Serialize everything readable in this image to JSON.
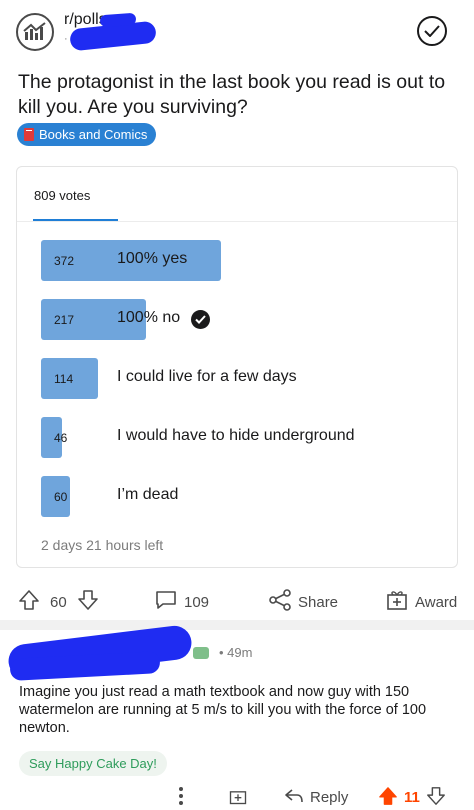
{
  "post": {
    "subreddit": "r/polls",
    "title": "The protagonist in the last book you read is out to kill you. Are you surviving?",
    "flair": "Books and Comics"
  },
  "poll": {
    "votes_label": "809 votes",
    "options": [
      {
        "count": "372",
        "label": "100% yes",
        "share": 0.46,
        "selected": false
      },
      {
        "count": "217",
        "label": "100% no",
        "share": 0.27,
        "selected": true
      },
      {
        "count": "114",
        "label": "I could live for a few days",
        "share": 0.14,
        "selected": false
      },
      {
        "count": "46",
        "label": "I would have to hide underground",
        "share": 0.06,
        "selected": false
      },
      {
        "count": "60",
        "label": "I’m dead",
        "share": 0.07,
        "selected": false
      }
    ],
    "time_left": "2 days 21 hours left"
  },
  "actions": {
    "score": "60",
    "comments": "109",
    "share_label": "Share",
    "award_label": "Award"
  },
  "comment": {
    "time": "• 49m",
    "body": "Imagine you just read a math textbook and now guy with 150 watermelon are running at 5 m/s to kill you with the force of 100 newton.",
    "cake_day": "Say Happy Cake Day!",
    "reply_label": "Reply",
    "score": "11"
  },
  "colors": {
    "accent": "#2a81d3",
    "poll_bar": "#6fa5dc",
    "upvote": "#ff4500",
    "redaction": "#1f2cf2",
    "cake_text": "#2e9c5b"
  },
  "icons": [
    "subreddit-avatar-icon",
    "checkmark-circle-icon",
    "book-icon",
    "upvote-icon",
    "downvote-icon",
    "comment-icon",
    "share-icon",
    "award-icon",
    "more-icon",
    "reply-icon"
  ]
}
